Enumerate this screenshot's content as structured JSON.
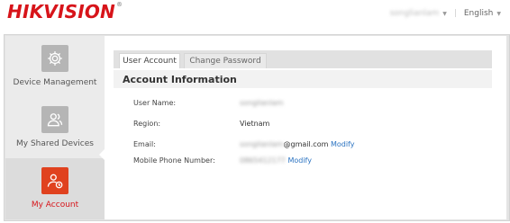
{
  "header": {
    "brand": "HIKVISION",
    "brand_mark": "®",
    "username": "songlianlam",
    "language": "English"
  },
  "sidebar": {
    "items": [
      {
        "label": "Device Management",
        "icon": "gear-icon",
        "active": false
      },
      {
        "label": "My Shared Devices",
        "icon": "shared-users-icon",
        "active": false
      },
      {
        "label": "My Account",
        "icon": "account-icon",
        "active": true
      }
    ]
  },
  "tabs": [
    {
      "label": "User Account",
      "active": true
    },
    {
      "label": "Change Password",
      "active": false
    }
  ],
  "account": {
    "section_title": "Account Information",
    "username_label": "User Name:",
    "username_value": "songlianlam",
    "region_label": "Region:",
    "region_value": "Vietnam",
    "email_label": "Email:",
    "email_hidden": "songlianlam",
    "email_domain": "@gmail.com",
    "email_modify": "Modify",
    "phone_label": "Mobile Phone Number:",
    "phone_value": "0865412177",
    "phone_modify": "Modify"
  },
  "colors": {
    "brand": "#d7141a",
    "link": "#2b73c1",
    "active_icon": "#e0421f"
  }
}
